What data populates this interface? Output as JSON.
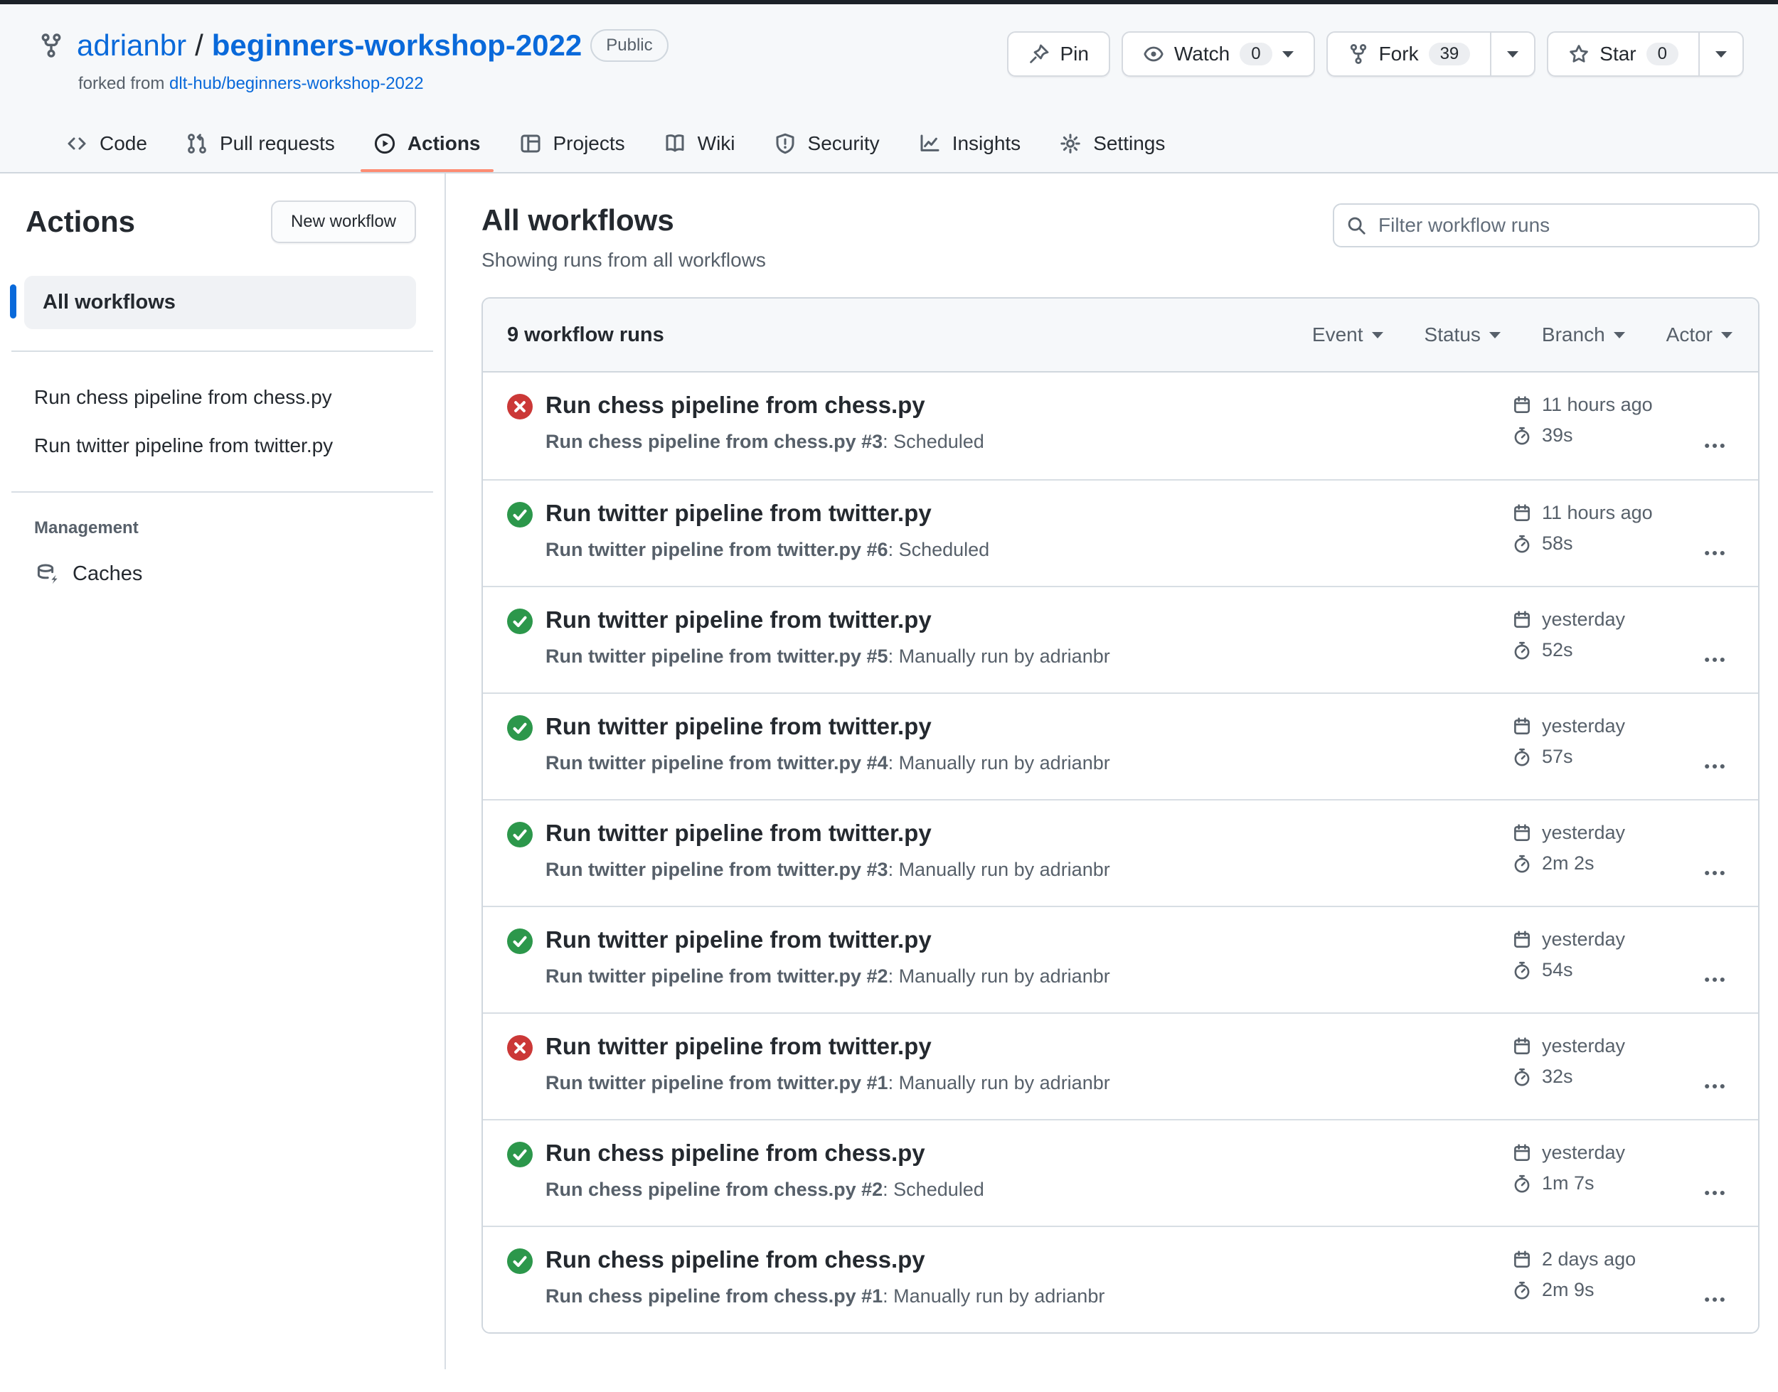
{
  "colors": {
    "topbar": "#1c2128",
    "header_bg": "#f6f8fa",
    "border": "#d0d7de",
    "text": "#24292f",
    "muted": "#57606a",
    "link": "#0969da",
    "accent": "#fd8c73",
    "marker": "#0969da",
    "selected_bg": "#f0f2f5",
    "counter_bg": "#eceef1",
    "success": "#2c974b",
    "danger": "#cb3837"
  },
  "header": {
    "owner": "adrianbr",
    "separator": "/",
    "repo": "beginners-workshop-2022",
    "visibility_badge": "Public",
    "forked_from_prefix": "forked from",
    "forked_from_link": "dlt-hub/beginners-workshop-2022",
    "buttons": {
      "pin_label": "Pin",
      "watch_label": "Watch",
      "watch_count": "0",
      "fork_label": "Fork",
      "fork_count": "39",
      "star_label": "Star",
      "star_count": "0"
    },
    "tabs": [
      {
        "label": "Code",
        "icon": "code-icon"
      },
      {
        "label": "Pull requests",
        "icon": "pull-request-icon"
      },
      {
        "label": "Actions",
        "icon": "play-circle-icon",
        "active": true
      },
      {
        "label": "Projects",
        "icon": "table-icon"
      },
      {
        "label": "Wiki",
        "icon": "book-icon"
      },
      {
        "label": "Security",
        "icon": "shield-icon"
      },
      {
        "label": "Insights",
        "icon": "graph-icon"
      },
      {
        "label": "Settings",
        "icon": "gear-icon"
      }
    ]
  },
  "sidebar": {
    "title": "Actions",
    "new_workflow_button": "New workflow",
    "all_workflows_label": "All workflows",
    "workflows": [
      "Run chess pipeline from chess.py",
      "Run twitter pipeline from twitter.py"
    ],
    "management_heading": "Management",
    "management_items": [
      {
        "label": "Caches",
        "icon": "cache-icon"
      }
    ]
  },
  "main": {
    "title": "All workflows",
    "subtitle": "Showing runs from all workflows",
    "filter_placeholder": "Filter workflow runs",
    "table": {
      "header": "9 workflow runs",
      "filters": [
        "Event",
        "Status",
        "Branch",
        "Actor"
      ],
      "runs": [
        {
          "status": "failure",
          "title": "Run chess pipeline from chess.py",
          "link_text": "Run chess pipeline from chess.py #3",
          "event_text": ": Scheduled",
          "time": "11 hours ago",
          "duration": "39s"
        },
        {
          "status": "success",
          "title": "Run twitter pipeline from twitter.py",
          "link_text": "Run twitter pipeline from twitter.py #6",
          "event_text": ": Scheduled",
          "time": "11 hours ago",
          "duration": "58s"
        },
        {
          "status": "success",
          "title": "Run twitter pipeline from twitter.py",
          "link_text": "Run twitter pipeline from twitter.py #5",
          "event_text": ": Manually run by adrianbr",
          "time": "yesterday",
          "duration": "52s"
        },
        {
          "status": "success",
          "title": "Run twitter pipeline from twitter.py",
          "link_text": "Run twitter pipeline from twitter.py #4",
          "event_text": ": Manually run by adrianbr",
          "time": "yesterday",
          "duration": "57s"
        },
        {
          "status": "success",
          "title": "Run twitter pipeline from twitter.py",
          "link_text": "Run twitter pipeline from twitter.py #3",
          "event_text": ": Manually run by adrianbr",
          "time": "yesterday",
          "duration": "2m 2s"
        },
        {
          "status": "success",
          "title": "Run twitter pipeline from twitter.py",
          "link_text": "Run twitter pipeline from twitter.py #2",
          "event_text": ": Manually run by adrianbr",
          "time": "yesterday",
          "duration": "54s"
        },
        {
          "status": "failure",
          "title": "Run twitter pipeline from twitter.py",
          "link_text": "Run twitter pipeline from twitter.py #1",
          "event_text": ": Manually run by adrianbr",
          "time": "yesterday",
          "duration": "32s"
        },
        {
          "status": "success",
          "title": "Run chess pipeline from chess.py",
          "link_text": "Run chess pipeline from chess.py #2",
          "event_text": ": Scheduled",
          "time": "yesterday",
          "duration": "1m 7s"
        },
        {
          "status": "success",
          "title": "Run chess pipeline from chess.py",
          "link_text": "Run chess pipeline from chess.py #1",
          "event_text": ": Manually run by adrianbr",
          "time": "2 days ago",
          "duration": "2m 9s"
        }
      ]
    }
  },
  "icons": {
    "meta_time": "calendar-icon",
    "meta_duration": "stopwatch-icon",
    "row_menu": "kebab-icon",
    "search": "search-icon",
    "status_success": "check-circle-icon",
    "status_failure": "x-circle-icon"
  }
}
